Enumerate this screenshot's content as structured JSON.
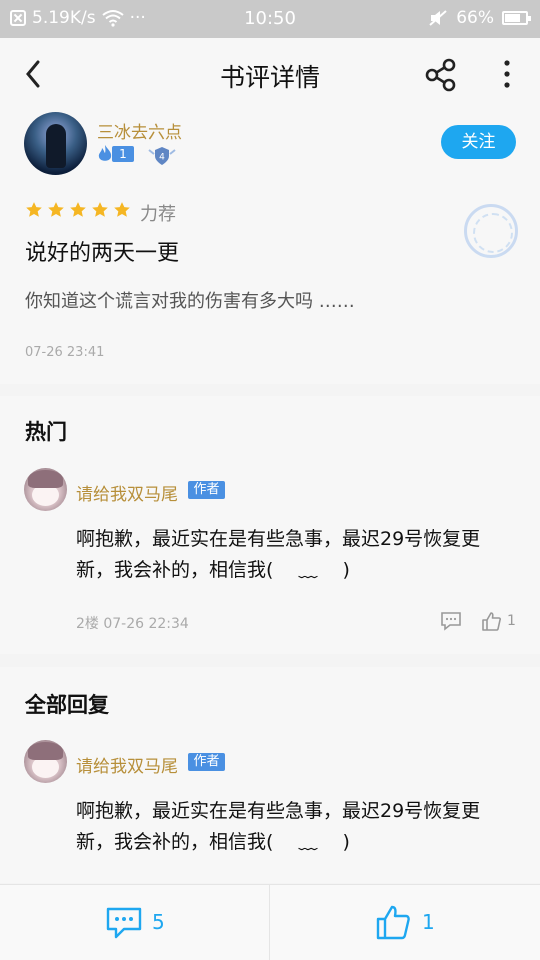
{
  "status_bar": {
    "speed": "5.19K/s",
    "dots": "···",
    "time": "10:50",
    "battery": "66%"
  },
  "header": {
    "title": "书评详情"
  },
  "review": {
    "username": "三冰去六点",
    "fan_level": "1",
    "shield_level": "4",
    "follow_label": "关注",
    "stars": 5,
    "rating_text": "力荐",
    "title": "说好的两天一更",
    "body": "你知道这个谎言对我的伤害有多大吗 ……",
    "time": "07-26 23:41"
  },
  "hot": {
    "title": "热门",
    "comments": [
      {
        "name": "请给我双马尾",
        "tag": "作者",
        "line1": "啊抱歉，最近实在是有些急事，最迟29号恢复更",
        "line2": "新，我会补的，相信我(　 ﹏　 )",
        "meta": "2楼 07-26 22:34",
        "likes": "1"
      }
    ]
  },
  "all": {
    "title": "全部回复",
    "comments": [
      {
        "name": "请给我双马尾",
        "tag": "作者",
        "line1": "啊抱歉，最近实在是有些急事，最迟29号恢复更",
        "line2": "新，我会补的，相信我(　 ﹏　 )"
      }
    ]
  },
  "bottom_bar": {
    "comment_count": "5",
    "like_count": "1"
  },
  "colors": {
    "accent": "#1ea7f0",
    "username": "#b78f3a",
    "author_tag": "#4a90e2",
    "star": "#f5b623"
  }
}
